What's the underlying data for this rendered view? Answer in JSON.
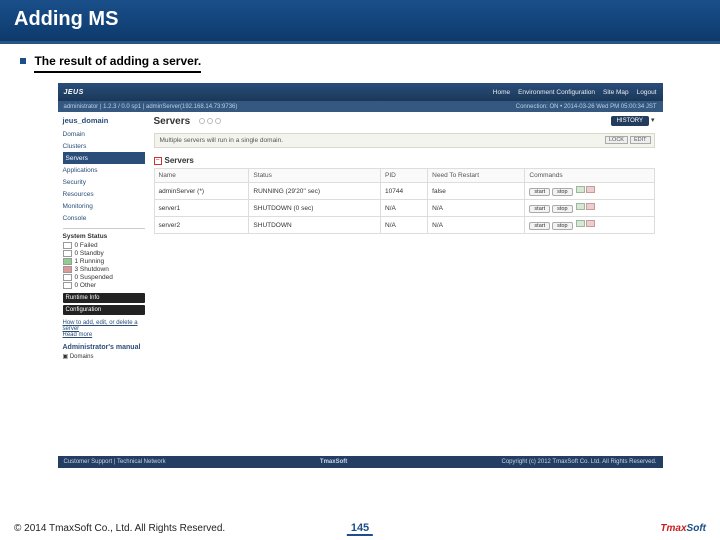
{
  "slide": {
    "title": "Adding MS",
    "subtitle": "The result of adding a server.",
    "page_number": "145",
    "copyright": "© 2014 TmaxSoft Co., Ltd. All Rights Reserved.",
    "brand_t": "Tmax",
    "brand_s": "Soft"
  },
  "app": {
    "logo": "JEUS",
    "nav_home": "Home",
    "nav_env": "Environment Configuration",
    "nav_site": "Site Map",
    "nav_logout": "Logout",
    "sub_left": "administrator | 1.2.3 / 0.0 sp1 | adminServer(192.168.14.73:9736)",
    "sub_right": "Connection: ON • 2014-03-26 Wed PM 05:00:34 JST",
    "footer_left": "Customer Support | Technical Network",
    "footer_mid": "TmaxSoft",
    "footer_right": "Copyright (c) 2012 TmaxSoft Co. Ltd. All Rights Reserved."
  },
  "sidebar": {
    "domain": "jeus_domain",
    "items": [
      {
        "label": "Domain"
      },
      {
        "label": "Clusters"
      },
      {
        "label": "Servers",
        "active": true
      },
      {
        "label": "Applications"
      },
      {
        "label": "Security"
      },
      {
        "label": "Resources"
      },
      {
        "label": "Monitoring"
      },
      {
        "label": "Console"
      }
    ],
    "status_title": "System Status",
    "status": [
      {
        "label": "0 Failed",
        "color": "#fff"
      },
      {
        "label": "0 Standby",
        "color": "#fff"
      },
      {
        "label": "1 Running",
        "color": "#8fce8f"
      },
      {
        "label": "3 Shutdown",
        "color": "#d99"
      },
      {
        "label": "0 Suspended",
        "color": "#fff"
      },
      {
        "label": "0 Other",
        "color": "#fff"
      }
    ],
    "btn1": "Runtime Info",
    "btn2": "Configuration",
    "help1": "How to add, edit, or delete a server",
    "help2": "Read more",
    "manual_title": "Administrator's manual",
    "manual_item": "Domains"
  },
  "main": {
    "breadcrumb": "Servers",
    "history": "HISTORY",
    "lock": "LOCK",
    "edit": "EDIT",
    "notice": "Multiple servers will run in a single domain.",
    "section": "Servers",
    "cols": [
      "Name",
      "Status",
      "PID",
      "Need To Restart",
      "Commands"
    ],
    "rows": [
      {
        "name": "adminServer (*)",
        "status": "RUNNING (29'20'' sec)",
        "pid": "10744",
        "restart": "false",
        "cmd1": "start",
        "cmd2": "stop"
      },
      {
        "name": "server1",
        "status": "SHUTDOWN (0 sec)",
        "pid": "N/A",
        "restart": "N/A",
        "cmd1": "start",
        "cmd2": "stop"
      },
      {
        "name": "server2",
        "status": "SHUTDOWN",
        "pid": "N/A",
        "restart": "N/A",
        "cmd1": "start",
        "cmd2": "stop"
      }
    ]
  }
}
